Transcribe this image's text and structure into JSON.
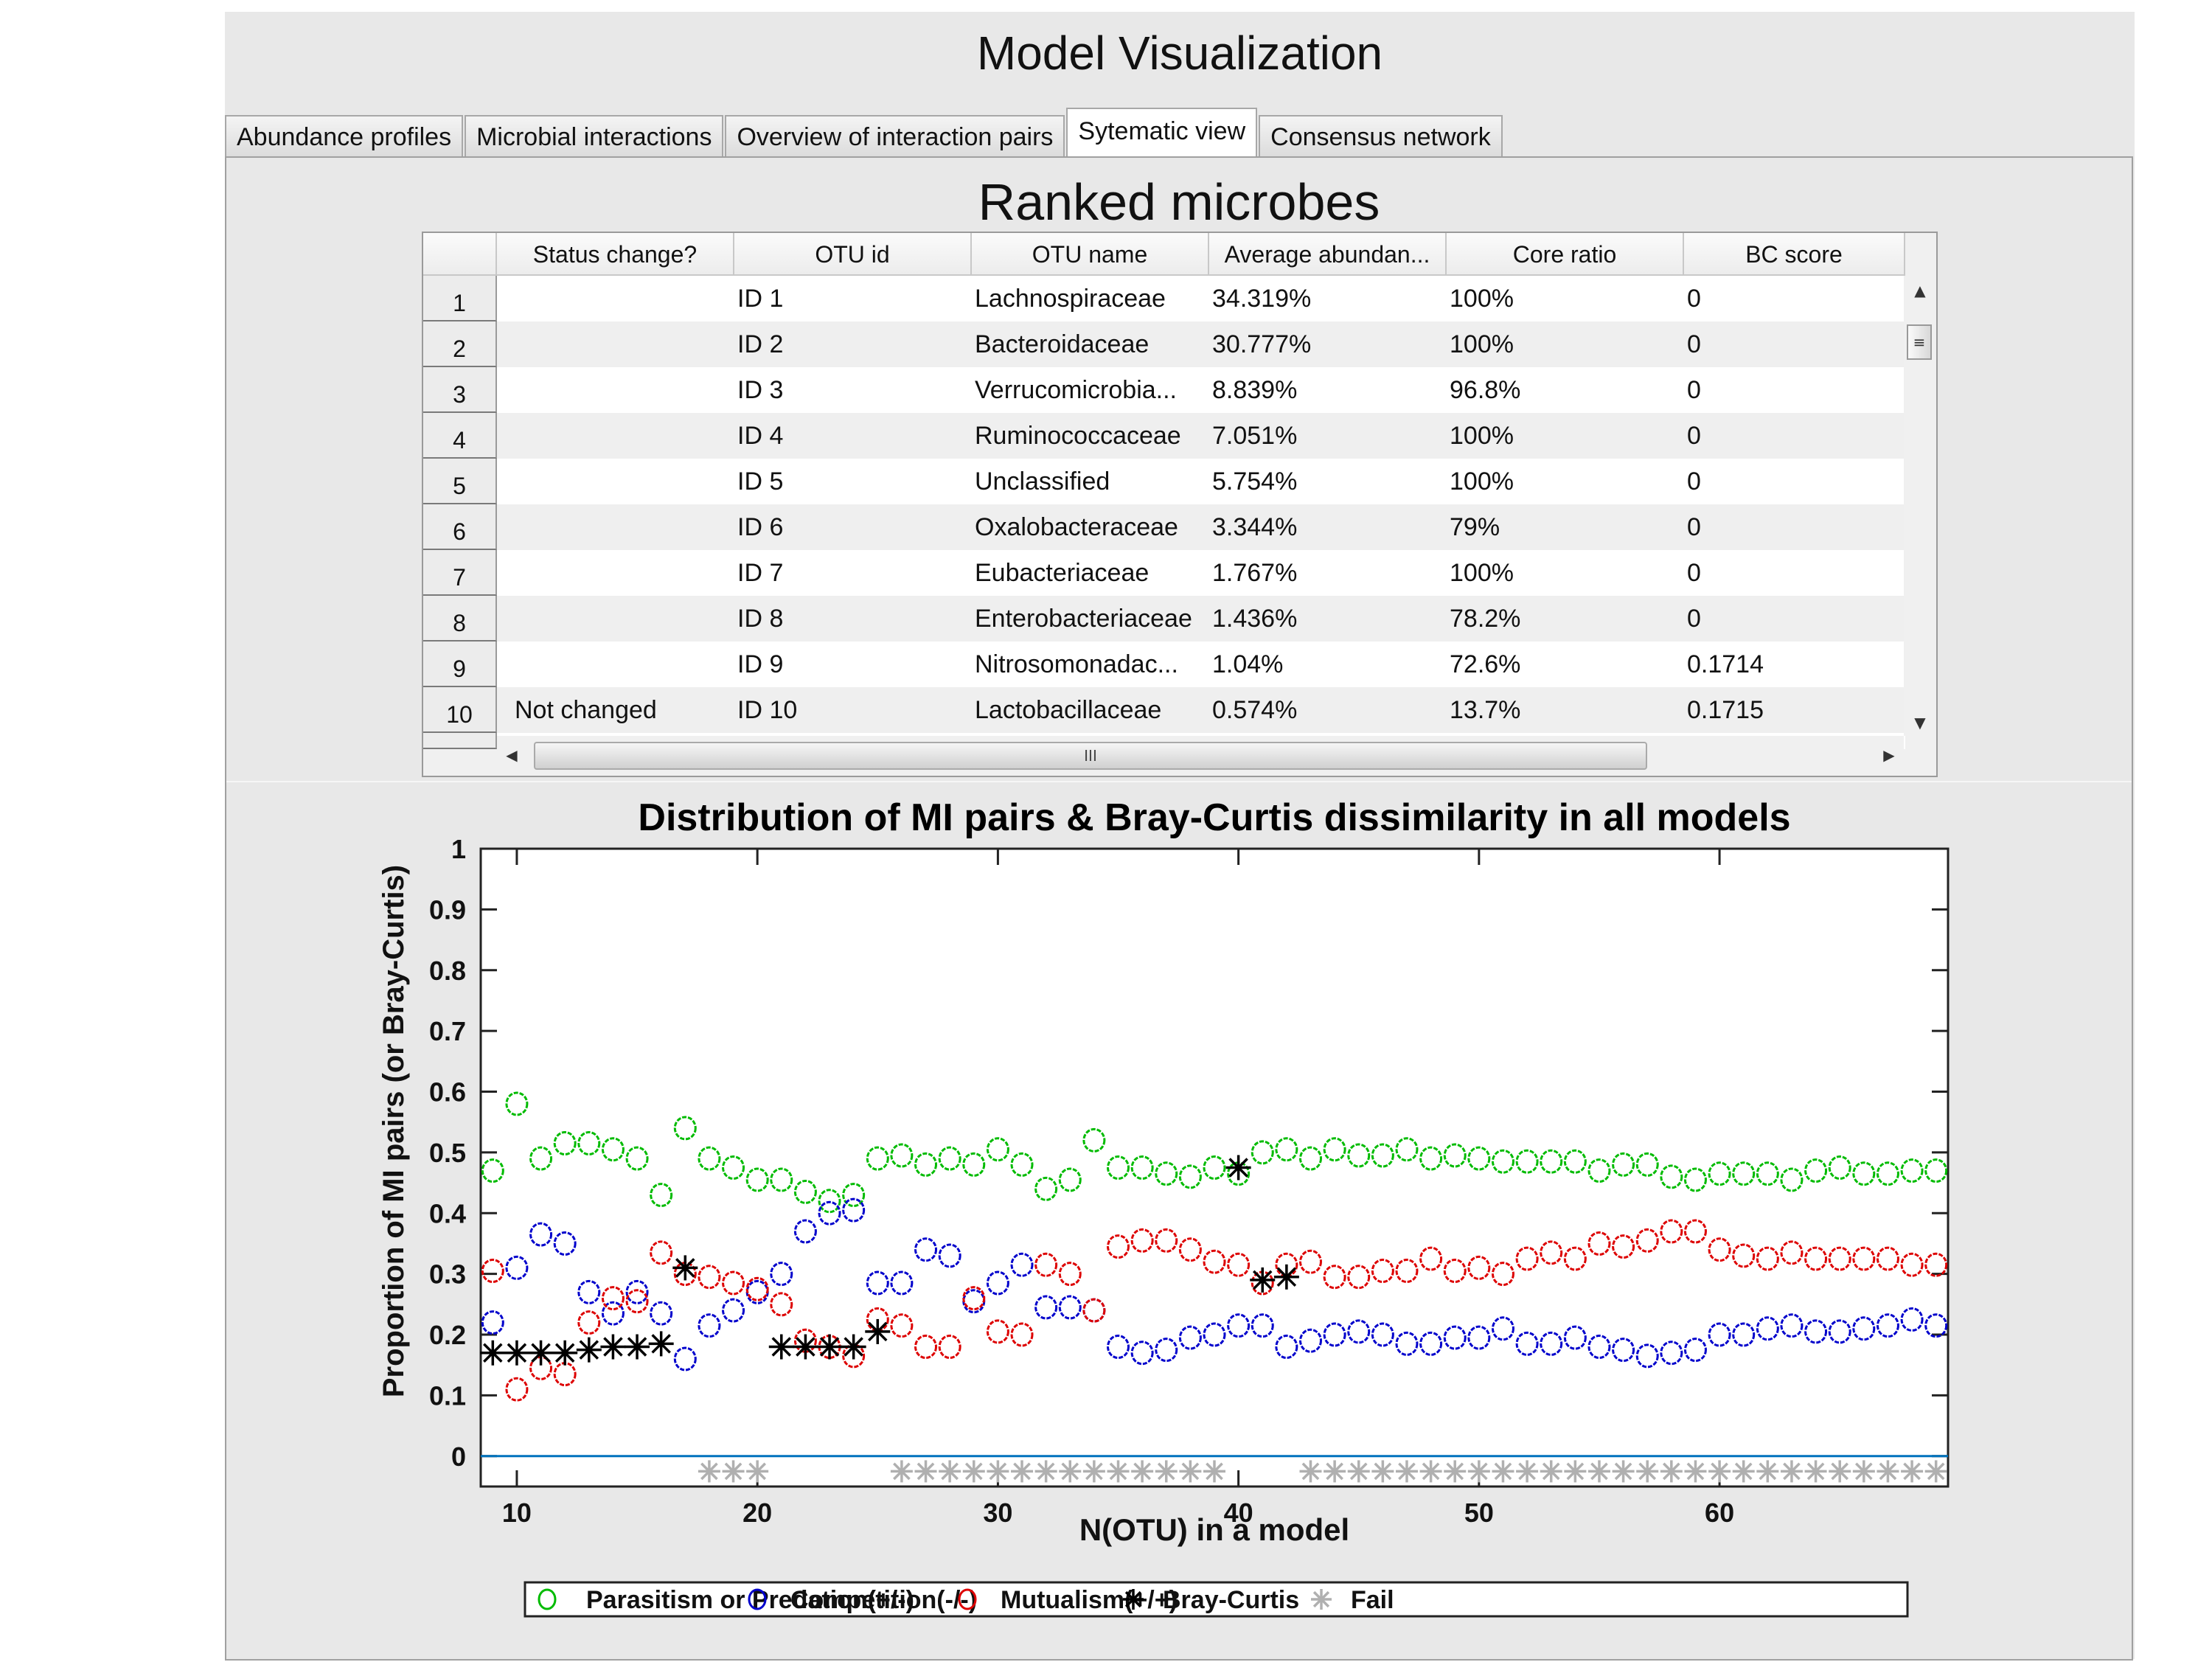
{
  "app_title": "Model Visualization",
  "tabs": [
    {
      "label": "Abundance profiles",
      "active": false
    },
    {
      "label": "Microbial interactions",
      "active": false
    },
    {
      "label": "Overview of interaction pairs",
      "active": false
    },
    {
      "label": "Sytematic view",
      "active": true
    },
    {
      "label": "Consensus network",
      "active": false
    }
  ],
  "table": {
    "title": "Ranked microbes",
    "columns": [
      "Status change?",
      "OTU id",
      "OTU name",
      "Average abundan...",
      "Core ratio",
      "BC score"
    ],
    "rows": [
      {
        "n": "1",
        "status": "",
        "id": "ID 1",
        "name": "Lachnospiraceae",
        "abund": "34.319%",
        "core": "100%",
        "bc": "0"
      },
      {
        "n": "2",
        "status": "",
        "id": "ID 2",
        "name": "Bacteroidaceae",
        "abund": "30.777%",
        "core": "100%",
        "bc": "0"
      },
      {
        "n": "3",
        "status": "",
        "id": "ID 3",
        "name": "Verrucomicrobia...",
        "abund": "8.839%",
        "core": "96.8%",
        "bc": "0"
      },
      {
        "n": "4",
        "status": "",
        "id": "ID 4",
        "name": "Ruminococcaceae",
        "abund": "7.051%",
        "core": "100%",
        "bc": "0"
      },
      {
        "n": "5",
        "status": "",
        "id": "ID 5",
        "name": "Unclassified",
        "abund": "5.754%",
        "core": "100%",
        "bc": "0"
      },
      {
        "n": "6",
        "status": "",
        "id": "ID 6",
        "name": "Oxalobacteraceae",
        "abund": "3.344%",
        "core": "79%",
        "bc": "0"
      },
      {
        "n": "7",
        "status": "",
        "id": "ID 7",
        "name": "Eubacteriaceae",
        "abund": "1.767%",
        "core": "100%",
        "bc": "0"
      },
      {
        "n": "8",
        "status": "",
        "id": "ID 8",
        "name": "Enterobacteriaceae",
        "abund": "1.436%",
        "core": "78.2%",
        "bc": "0"
      },
      {
        "n": "9",
        "status": "",
        "id": "ID 9",
        "name": "Nitrosomonadac...",
        "abund": "1.04%",
        "core": "72.6%",
        "bc": "0.1714"
      },
      {
        "n": "10",
        "status": "Not changed",
        "id": "ID 10",
        "name": "Lactobacillaceae",
        "abund": "0.574%",
        "core": "13.7%",
        "bc": "0.1715"
      }
    ],
    "scroll_up": "▲",
    "scroll_down": "▼",
    "scroll_left": "◀",
    "scroll_right": "▶",
    "vthumb_grip": "≡",
    "hthumb_grip": "III"
  },
  "chart_data": {
    "type": "scatter",
    "title": "Distribution of MI pairs & Bray-Curtis dissimilarity in all models",
    "xlabel": "N(OTU) in a model",
    "ylabel": "Proportion of MI pairs (or Bray-Curtis)",
    "xlim": [
      8.5,
      69.5
    ],
    "ylim": [
      -0.05,
      1
    ],
    "xticks": [
      10,
      20,
      30,
      40,
      50,
      60
    ],
    "yticks": [
      0,
      0.1,
      0.2,
      0.3,
      0.4,
      0.5,
      0.6,
      0.7,
      0.8,
      0.9,
      1
    ],
    "ytick_labels": [
      "0",
      "0.1",
      "0.2",
      "0.3",
      "0.4",
      "0.5",
      "0.6",
      "0.7",
      "0.8",
      "0.9",
      "1"
    ],
    "zero_line": 0,
    "legend_position": "bottom",
    "series": [
      {
        "name": "Parasitism or Predation(+/-)",
        "marker": "circle",
        "color": "#00bb00",
        "x_start": 9,
        "values": [
          0.47,
          0.58,
          0.49,
          0.515,
          0.515,
          0.505,
          0.49,
          0.43,
          0.54,
          0.49,
          0.475,
          0.455,
          0.455,
          0.435,
          0.42,
          0.43,
          0.49,
          0.495,
          0.48,
          0.49,
          0.48,
          0.505,
          0.48,
          0.44,
          0.455,
          0.52,
          0.475,
          0.475,
          0.465,
          0.46,
          0.475,
          0.465,
          0.5,
          0.505,
          0.49,
          0.505,
          0.495,
          0.495,
          0.505,
          0.49,
          0.495,
          0.49,
          0.485,
          0.485,
          0.485,
          0.485,
          0.47,
          0.48,
          0.48,
          0.46,
          0.455,
          0.465,
          0.465,
          0.465,
          0.455,
          0.47,
          0.475,
          0.465,
          0.465,
          0.47,
          0.47
        ]
      },
      {
        "name": "Competition(-/-)",
        "marker": "circle",
        "color": "#0000cc",
        "x_start": 9,
        "values": [
          0.22,
          0.31,
          0.365,
          0.35,
          0.27,
          0.235,
          0.27,
          0.235,
          0.16,
          0.215,
          0.24,
          0.27,
          0.3,
          0.37,
          0.4,
          0.405,
          0.285,
          0.285,
          0.34,
          0.33,
          0.255,
          0.285,
          0.315,
          0.245,
          0.245,
          0.24,
          0.18,
          0.17,
          0.175,
          0.195,
          0.2,
          0.215,
          0.215,
          0.18,
          0.19,
          0.2,
          0.205,
          0.2,
          0.185,
          0.185,
          0.195,
          0.195,
          0.21,
          0.185,
          0.185,
          0.195,
          0.18,
          0.175,
          0.165,
          0.17,
          0.175,
          0.2,
          0.2,
          0.21,
          0.215,
          0.205,
          0.205,
          0.21,
          0.215,
          0.225,
          0.215
        ]
      },
      {
        "name": "Mutualism(+/+)",
        "marker": "circle",
        "color": "#dd0000",
        "x_start": 9,
        "values": [
          0.305,
          0.11,
          0.145,
          0.135,
          0.22,
          0.26,
          0.255,
          0.335,
          0.3,
          0.295,
          0.285,
          0.275,
          0.25,
          0.19,
          0.18,
          0.165,
          0.225,
          0.215,
          0.18,
          0.18,
          0.26,
          0.205,
          0.2,
          0.315,
          0.3,
          0.24,
          0.345,
          0.355,
          0.355,
          0.34,
          0.32,
          0.315,
          0.285,
          0.315,
          0.32,
          0.295,
          0.295,
          0.305,
          0.305,
          0.325,
          0.305,
          0.31,
          0.3,
          0.325,
          0.335,
          0.325,
          0.35,
          0.345,
          0.355,
          0.37,
          0.37,
          0.34,
          0.33,
          0.325,
          0.335,
          0.325,
          0.325,
          0.325,
          0.325,
          0.315,
          0.315
        ]
      },
      {
        "name": "Bray-Curtis",
        "marker": "star",
        "color": "#000000",
        "points": [
          [
            9,
            0.17
          ],
          [
            10,
            0.17
          ],
          [
            11,
            0.17
          ],
          [
            12,
            0.17
          ],
          [
            13,
            0.175
          ],
          [
            14,
            0.18
          ],
          [
            15,
            0.18
          ],
          [
            16,
            0.185
          ],
          [
            17,
            0.31
          ],
          [
            21,
            0.18
          ],
          [
            22,
            0.18
          ],
          [
            23,
            0.18
          ],
          [
            24,
            0.18
          ],
          [
            25,
            0.205
          ],
          [
            40,
            0.475
          ],
          [
            41,
            0.29
          ],
          [
            42,
            0.295
          ]
        ]
      },
      {
        "name": "Fail",
        "marker": "star",
        "color": "#b0b0b0",
        "y": -0.025,
        "x": [
          18,
          19,
          20,
          26,
          27,
          28,
          29,
          30,
          31,
          32,
          33,
          34,
          35,
          36,
          37,
          38,
          39,
          43,
          44,
          45,
          46,
          47,
          48,
          49,
          50,
          51,
          52,
          53,
          54,
          55,
          56,
          57,
          58,
          59,
          60,
          61,
          62,
          63,
          64,
          65,
          66,
          67,
          68,
          69
        ]
      }
    ],
    "colors": {
      "zero_line": "#0072bd"
    }
  }
}
